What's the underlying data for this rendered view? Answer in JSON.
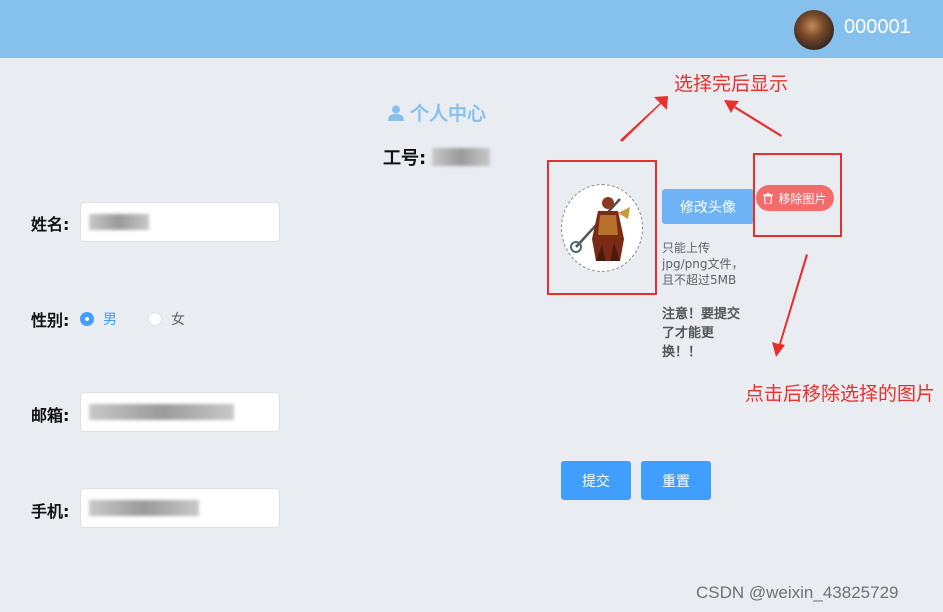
{
  "header": {
    "user_id": "000001",
    "avatar_icon": "user-avatar-icon"
  },
  "page": {
    "title": "个人中心",
    "title_icon": "user-icon",
    "work_no_label": "工号:"
  },
  "form": {
    "name_label": "姓名:",
    "gender_label": "性别:",
    "gender_options": [
      "男",
      "女"
    ],
    "gender_selected": "男",
    "email_label": "邮箱:",
    "phone_label": "手机:"
  },
  "avatar": {
    "change_button": "修改头像",
    "remove_button": "移除图片",
    "remove_icon": "trash-icon",
    "hint": "只能上传jpg/png文件，且不超过5MB",
    "warning": "注意！要提交了才能更换！！"
  },
  "actions": {
    "submit": "提交",
    "reset": "重置"
  },
  "annotations": {
    "top": "选择完后显示",
    "bottom": "点击后移除选择的图片"
  },
  "watermark": "CSDN @weixin_43825729",
  "colors": {
    "header": "#86c1ee",
    "primary": "#409eff",
    "danger": "#f36c6c",
    "annotation": "#e5302d"
  }
}
